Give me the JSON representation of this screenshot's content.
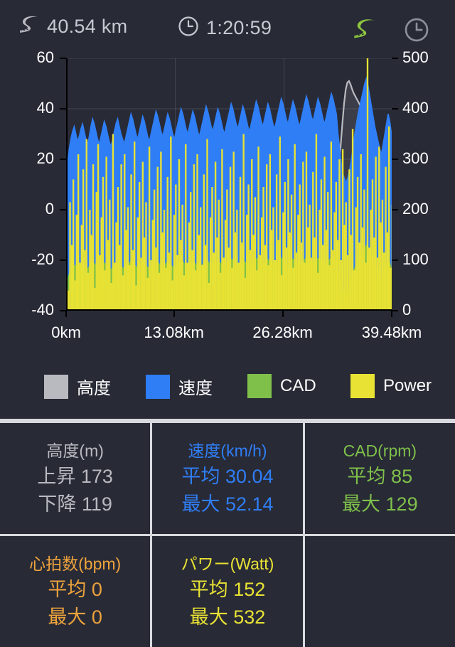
{
  "header": {
    "distance": "40.54 km",
    "duration": "1:20:59",
    "road_icon": "road-icon",
    "clock_icon": "clock-icon",
    "road_icon_right": "road-icon",
    "clock_icon_right": "clock-icon"
  },
  "colors": {
    "background": "#282a36",
    "elevation": "#b9bac0",
    "speed": "#2f7ef5",
    "cadence": "#7fc04a",
    "power": "#e8e234",
    "heartrate": "#eda33c",
    "grid": "#d8d9de",
    "header_text": "#c7c9d1"
  },
  "chart_data": {
    "type": "area",
    "title": "",
    "xlabel": "",
    "ylabel": "",
    "grid": true,
    "legend_position": "bottom",
    "x_ticks": [
      "0km",
      "13.08km",
      "26.28km",
      "39.48km"
    ],
    "x_tick_positions": [
      0,
      33.1,
      66.5,
      100
    ],
    "left_axis": {
      "ticks": [
        60,
        40,
        20,
        0,
        -20,
        -40
      ],
      "ylim": [
        -40,
        60
      ]
    },
    "right_axis": {
      "ticks": [
        500,
        400,
        300,
        200,
        100,
        0
      ],
      "ylim": [
        0,
        500
      ]
    },
    "x_range_km": [
      0,
      40.54
    ],
    "series": [
      {
        "name": "高度",
        "legend": "高度",
        "color": "#b9bac0",
        "axis": "right",
        "style": "area",
        "unit": "m",
        "values": [
          170,
          176,
          182,
          179,
          174,
          171,
          168,
          166,
          170,
          175,
          180,
          183,
          179,
          175,
          172,
          170,
          173,
          178,
          182,
          186,
          183,
          179,
          176,
          173,
          171,
          174,
          178,
          181,
          184,
          182,
          179,
          176,
          174,
          177,
          180,
          184,
          187,
          185,
          182,
          179,
          177,
          180,
          183,
          186,
          184,
          181,
          178,
          176,
          179,
          182,
          186,
          189,
          187,
          184,
          181,
          179,
          182,
          185,
          188,
          186,
          183,
          180,
          178,
          181,
          184,
          187,
          190,
          188,
          185,
          182,
          180,
          183,
          186,
          189,
          192,
          190,
          187,
          184,
          182,
          185,
          188,
          191,
          189,
          186,
          184,
          182,
          185,
          188,
          191,
          194,
          192,
          189,
          186,
          184,
          187,
          190,
          193,
          196,
          194,
          191,
          188,
          186,
          189,
          192,
          195,
          198,
          196,
          193,
          190,
          188,
          191,
          194,
          197,
          200,
          198,
          195,
          192,
          190,
          193,
          196,
          199,
          202,
          200,
          197,
          194,
          192,
          195,
          198,
          201,
          204,
          202,
          199,
          196,
          194,
          197,
          200,
          203,
          206,
          204,
          201,
          198,
          196,
          199,
          202,
          205,
          208,
          206,
          203,
          200,
          198,
          201,
          204,
          207,
          210,
          208,
          205,
          202,
          200,
          203,
          206,
          209,
          212,
          215,
          222,
          236,
          258,
          290,
          330,
          372,
          410,
          438,
          452,
          455,
          448,
          438,
          430,
          424,
          418,
          412,
          405,
          398,
          392,
          385,
          378,
          370,
          362,
          352,
          340,
          325,
          308,
          290,
          272,
          255,
          240,
          228,
          218,
          210,
          204,
          200,
          198
        ]
      },
      {
        "name": "速度",
        "legend": "速度",
        "color": "#2f7ef5",
        "axis": "left",
        "style": "area",
        "unit": "km/h",
        "avg": 30.04,
        "max": 52.14,
        "values": [
          18,
          24,
          28,
          31,
          33,
          30,
          27,
          29,
          32,
          34,
          31,
          28,
          26,
          29,
          33,
          36,
          34,
          31,
          28,
          26,
          29,
          32,
          35,
          33,
          30,
          27,
          25,
          28,
          31,
          34,
          36,
          33,
          30,
          28,
          26,
          29,
          32,
          35,
          38,
          36,
          33,
          30,
          28,
          31,
          34,
          37,
          35,
          32,
          29,
          27,
          30,
          33,
          36,
          39,
          37,
          34,
          31,
          29,
          32,
          35,
          38,
          36,
          33,
          30,
          28,
          31,
          34,
          37,
          40,
          38,
          35,
          32,
          30,
          33,
          36,
          39,
          37,
          34,
          31,
          29,
          32,
          35,
          38,
          41,
          39,
          36,
          33,
          31,
          34,
          37,
          40,
          38,
          35,
          32,
          30,
          33,
          36,
          39,
          42,
          40,
          37,
          34,
          32,
          35,
          38,
          41,
          39,
          36,
          33,
          31,
          34,
          37,
          40,
          43,
          41,
          38,
          35,
          33,
          36,
          39,
          42,
          40,
          37,
          34,
          32,
          35,
          38,
          41,
          44,
          42,
          39,
          36,
          34,
          37,
          40,
          43,
          41,
          38,
          35,
          33,
          36,
          39,
          42,
          45,
          43,
          40,
          37,
          35,
          38,
          41,
          44,
          42,
          39,
          36,
          34,
          37,
          40,
          43,
          46,
          44,
          41,
          38,
          30,
          24,
          18,
          14,
          12,
          11,
          13,
          16,
          20,
          25,
          30,
          34,
          38,
          41,
          44,
          47,
          50,
          52,
          49,
          45,
          41,
          37,
          33,
          30,
          27,
          24,
          22,
          26,
          30,
          34,
          38,
          35,
          30,
          22
        ]
      },
      {
        "name": "CAD",
        "legend": "CAD",
        "color": "#7fc04a",
        "axis": "right",
        "style": "area",
        "unit": "rpm",
        "avg": 85,
        "max": 129,
        "values": [
          60,
          72,
          80,
          86,
          90,
          88,
          84,
          87,
          91,
          94,
          90,
          86,
          83,
          87,
          92,
          96,
          93,
          89,
          85,
          82,
          86,
          90,
          94,
          91,
          87,
          84,
          81,
          85,
          89,
          93,
          96,
          92,
          88,
          85,
          82,
          86,
          90,
          94,
          98,
          95,
          91,
          87,
          84,
          88,
          92,
          96,
          93,
          89,
          86,
          83,
          87,
          91,
          95,
          99,
          96,
          92,
          88,
          85,
          89,
          93,
          97,
          94,
          90,
          86,
          83,
          87,
          91,
          95,
          100,
          97,
          93,
          89,
          86,
          90,
          94,
          98,
          95,
          91,
          87,
          84,
          88,
          92,
          96,
          101,
          98,
          94,
          90,
          87,
          91,
          95,
          99,
          96,
          92,
          88,
          85,
          89,
          93,
          97,
          102,
          99,
          95,
          91,
          88,
          92,
          96,
          100,
          97,
          93,
          89,
          86,
          90,
          94,
          98,
          103,
          100,
          96,
          92,
          89,
          93,
          97,
          101,
          98,
          94,
          90,
          87,
          91,
          95,
          99,
          104,
          101,
          97,
          93,
          90,
          94,
          98,
          102,
          99,
          95,
          91,
          88,
          92,
          96,
          100,
          105,
          102,
          98,
          94,
          91,
          95,
          99,
          103,
          100,
          96,
          92,
          89,
          93,
          97,
          101,
          106,
          103,
          99,
          95,
          80,
          62,
          48,
          40,
          36,
          34,
          40,
          50,
          62,
          74,
          84,
          92,
          98,
          104,
          110,
          116,
          122,
          129,
          124,
          116,
          108,
          100,
          92,
          85,
          78,
          70,
          64,
          72,
          82,
          92,
          100,
          94,
          82,
          60
        ]
      },
      {
        "name": "Power",
        "legend": "Power",
        "color": "#e8e234",
        "axis": "right",
        "style": "bar",
        "unit": "Watt",
        "avg": 152,
        "max": 532,
        "values": [
          40,
          215,
          130,
          260,
          60,
          190,
          310,
          95,
          170,
          280,
          120,
          340,
          75,
          200,
          150,
          290,
          45,
          235,
          330,
          110,
          185,
          265,
          80,
          305,
          140,
          220,
          55,
          350,
          95,
          175,
          245,
          130,
          290,
          70,
          310,
          160,
          205,
          90,
          270,
          120,
          335,
          50,
          185,
          255,
          105,
          295,
          145,
          215,
          65,
          325,
          100,
          180,
          240,
          125,
          285,
          75,
          315,
          155,
          200,
          85,
          265,
          115,
          345,
          60,
          190,
          250,
          110,
          300,
          140,
          210,
          70,
          330,
          95,
          175,
          235,
          120,
          290,
          80,
          310,
          150,
          205,
          90,
          270,
          130,
          340,
          55,
          185,
          245,
          115,
          295,
          145,
          220,
          75,
          320,
          105,
          180,
          240,
          125,
          285,
          85,
          315,
          155,
          200,
          95,
          265,
          135,
          350,
          65,
          190,
          250,
          120,
          300,
          150,
          225,
          80,
          325,
          110,
          185,
          245,
          130,
          290,
          90,
          310,
          160,
          205,
          100,
          270,
          140,
          345,
          70,
          195,
          255,
          125,
          300,
          155,
          230,
          85,
          330,
          115,
          190,
          250,
          135,
          295,
          95,
          315,
          165,
          210,
          105,
          275,
          145,
          350,
          75,
          200,
          260,
          130,
          305,
          160,
          235,
          90,
          335,
          120,
          195,
          255,
          140,
          300,
          100,
          320,
          170,
          215,
          110,
          280,
          150,
          360,
          80,
          205,
          265,
          135,
          310,
          165,
          240,
          95,
          532,
          125,
          200,
          260,
          145,
          305,
          105,
          325,
          175,
          220,
          115,
          285,
          155,
          365,
          85,
          210
        ]
      }
    ]
  },
  "legend": [
    {
      "label": "高度",
      "color": "#b9bac0",
      "swatch": "legend-swatch"
    },
    {
      "label": "速度",
      "color": "#2f7ef5",
      "swatch": "legend-swatch"
    },
    {
      "label": "CAD",
      "color": "#7fc04a",
      "swatch": "legend-swatch"
    },
    {
      "label": "Power",
      "color": "#e8e234",
      "swatch": "legend-swatch"
    }
  ],
  "stats": [
    {
      "title": "高度(m)",
      "color": "#b9bac0",
      "rows": [
        "上昇 173",
        "下降 119"
      ],
      "name": "elevation"
    },
    {
      "title": "速度(km/h)",
      "color": "#2f7ef5",
      "rows": [
        "平均 30.04",
        "最大 52.14"
      ],
      "name": "speed"
    },
    {
      "title": "CAD(rpm)",
      "color": "#7fc04a",
      "rows": [
        "平均 85",
        "最大 129"
      ],
      "name": "cadence"
    },
    {
      "title": "心拍数(bpm)",
      "color": "#eda33c",
      "rows": [
        "平均 0",
        "最大 0"
      ],
      "name": "heartrate"
    },
    {
      "title": "パワー(Watt)",
      "color": "#e8e234",
      "rows": [
        "平均 152",
        "最大 532"
      ],
      "name": "power"
    },
    {
      "title": "",
      "color": "#282a36",
      "rows": [],
      "name": "empty"
    }
  ]
}
